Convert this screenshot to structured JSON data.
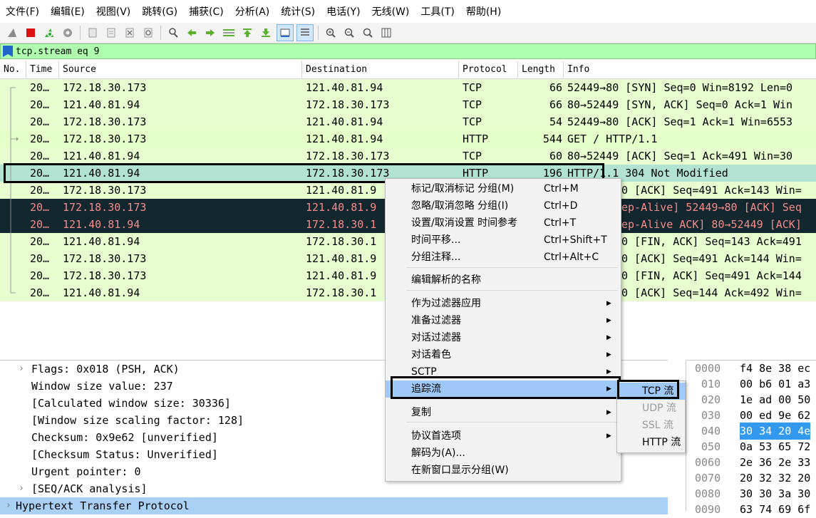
{
  "menubar": [
    "文件(F)",
    "编辑(E)",
    "视图(V)",
    "跳转(G)",
    "捕获(C)",
    "分析(A)",
    "统计(S)",
    "电话(Y)",
    "无线(W)",
    "工具(T)",
    "帮助(H)"
  ],
  "toolbar_icons": [
    "shark-fin-icon",
    "stop-icon",
    "restart-icon",
    "options-gear-icon",
    "open-file-icon",
    "save-file-icon",
    "close-file-icon",
    "reload-icon",
    "find-icon",
    "back-arrow-icon",
    "forward-arrow-icon",
    "goto-packet-icon",
    "first-packet-icon",
    "last-packet-icon",
    "autoscroll-icon",
    "colorize-icon",
    "zoom-in-icon",
    "zoom-out-icon",
    "zoom-reset-icon",
    "resize-columns-icon"
  ],
  "filter": {
    "value": "tcp.stream eq 9"
  },
  "columns": [
    "No.",
    "Time",
    "Source",
    "Destination",
    "Protocol",
    "Length",
    "Info"
  ],
  "packets": [
    {
      "time": "20…",
      "src": "172.18.30.173",
      "dst": "121.40.81.94",
      "proto": "TCP",
      "len": "66",
      "info": "52449→80 [SYN] Seq=0 Win=8192 Len=0"
    },
    {
      "time": "20…",
      "src": "121.40.81.94",
      "dst": "172.18.30.173",
      "proto": "TCP",
      "len": "66",
      "info": "80→52449 [SYN, ACK] Seq=0 Ack=1 Win"
    },
    {
      "time": "20…",
      "src": "172.18.30.173",
      "dst": "121.40.81.94",
      "proto": "TCP",
      "len": "54",
      "info": "52449→80 [ACK] Seq=1 Ack=1 Win=6553"
    },
    {
      "time": "20…",
      "src": "172.18.30.173",
      "dst": "121.40.81.94",
      "proto": "HTTP",
      "len": "544",
      "info": "GET / HTTP/1.1"
    },
    {
      "time": "20…",
      "src": "121.40.81.94",
      "dst": "172.18.30.173",
      "proto": "TCP",
      "len": "60",
      "info": "80→52449 [ACK] Seq=1 Ack=491 Win=30"
    },
    {
      "time": "20…",
      "src": "121.40.81.94",
      "dst": "172.18.30.173",
      "proto": "HTTP",
      "len": "196",
      "info": "HTTP/1.1 304 Not Modified"
    },
    {
      "time": "20…",
      "src": "172.18.30.173",
      "dst": "121.40.81.9",
      "proto": "",
      "len": "",
      "info": "0 [ACK] Seq=491 Ack=143 Win="
    },
    {
      "time": "20…",
      "src": "172.18.30.173",
      "dst": "121.40.81.9",
      "proto": "",
      "len": "",
      "info": "ep-Alive] 52449→80 [ACK] Seq"
    },
    {
      "time": "20…",
      "src": "121.40.81.94",
      "dst": "172.18.30.1",
      "proto": "",
      "len": "",
      "info": "ep-Alive ACK] 80→52449 [ACK]"
    },
    {
      "time": "20…",
      "src": "121.40.81.94",
      "dst": "172.18.30.1",
      "proto": "",
      "len": "",
      "info": "0 [FIN, ACK] Seq=143 Ack=491"
    },
    {
      "time": "20…",
      "src": "172.18.30.173",
      "dst": "121.40.81.9",
      "proto": "",
      "len": "",
      "info": "0 [ACK] Seq=491 Ack=144 Win="
    },
    {
      "time": "20…",
      "src": "172.18.30.173",
      "dst": "121.40.81.9",
      "proto": "",
      "len": "",
      "info": "0 [FIN, ACK] Seq=491 Ack=144"
    },
    {
      "time": "20…",
      "src": "121.40.81.94",
      "dst": "172.18.30.1",
      "proto": "",
      "len": "",
      "info": "0 [ACK] Seq=144 Ack=492 Win="
    }
  ],
  "details": [
    {
      "text": "Flags: 0x018 (PSH, ACK)",
      "expander": "›"
    },
    {
      "text": "Window size value: 237",
      "expander": ""
    },
    {
      "text": "[Calculated window size: 30336]",
      "expander": ""
    },
    {
      "text": "[Window size scaling factor: 128]",
      "expander": ""
    },
    {
      "text": "Checksum: 0x9e62 [unverified]",
      "expander": ""
    },
    {
      "text": "[Checksum Status: Unverified]",
      "expander": ""
    },
    {
      "text": "Urgent pointer: 0",
      "expander": ""
    },
    {
      "text": "[SEQ/ACK analysis]",
      "expander": "›"
    },
    {
      "text": "Hypertext Transfer Protocol",
      "expander": "›"
    }
  ],
  "hex": [
    {
      "off": "0000",
      "bytes": "f4 8e 38 ec"
    },
    {
      "off": "010",
      "bytes": "00 b6 01 a3"
    },
    {
      "off": "020",
      "bytes": "1e ad 00 50"
    },
    {
      "off": "030",
      "bytes": "00 ed 9e 62"
    },
    {
      "off": "040",
      "bytes": "30 34 20 4e"
    },
    {
      "off": "050",
      "bytes": "0a 53 65 72"
    },
    {
      "off": "0060",
      "bytes": "2e 36 2e 33"
    },
    {
      "off": "0070",
      "bytes": "20 32 32 20"
    },
    {
      "off": "0080",
      "bytes": "30 30 3a 30"
    },
    {
      "off": "0090",
      "bytes": "63 74 69 6f"
    }
  ],
  "context_menu": {
    "items": [
      {
        "label": "标记/取消标记 分组(M)",
        "shortcut": "Ctrl+M"
      },
      {
        "label": "忽略/取消忽略 分组(I)",
        "shortcut": "Ctrl+D"
      },
      {
        "label": "设置/取消设置 时间参考",
        "shortcut": "Ctrl+T"
      },
      {
        "label": "时间平移...",
        "shortcut": "Ctrl+Shift+T"
      },
      {
        "label": "分组注释...",
        "shortcut": "Ctrl+Alt+C"
      },
      {
        "label": "编辑解析的名称",
        "shortcut": ""
      },
      {
        "label": "作为过滤器应用",
        "shortcut": ""
      },
      {
        "label": "准备过滤器",
        "shortcut": ""
      },
      {
        "label": "对话过滤器",
        "shortcut": ""
      },
      {
        "label": "对话着色",
        "shortcut": ""
      },
      {
        "label": "SCTP",
        "shortcut": ""
      },
      {
        "label": "追踪流",
        "shortcut": ""
      },
      {
        "label": "复制",
        "shortcut": ""
      },
      {
        "label": "协议首选项",
        "shortcut": ""
      },
      {
        "label": "解码为(A)...",
        "shortcut": ""
      },
      {
        "label": "在新窗口显示分组(W)",
        "shortcut": ""
      }
    ]
  },
  "submenu": {
    "items": [
      {
        "label": "TCP 流",
        "enabled": true
      },
      {
        "label": "UDP 流",
        "enabled": false
      },
      {
        "label": "SSL 流",
        "enabled": false
      },
      {
        "label": "HTTP 流",
        "enabled": true
      }
    ]
  },
  "colors": {
    "tcp_row": "#e7fccf",
    "http_row": "#e4ffc7",
    "selected_row": "#b2e2d2",
    "bad_row_bg": "#12272e",
    "bad_row_fg": "#f78b8b",
    "filter_valid": "#afffaf",
    "menu_highlight": "#9ec8f7",
    "hex_selected": "#3399ee"
  }
}
